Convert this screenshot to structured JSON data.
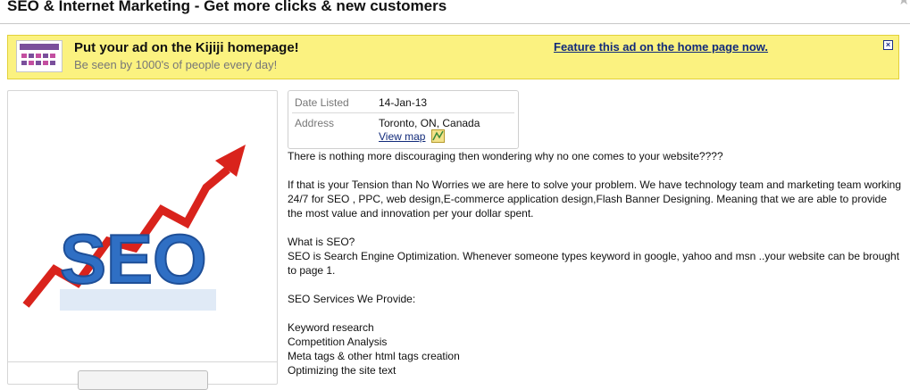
{
  "listing": {
    "title": "SEO & Internet Marketing - Get more clicks & new customers"
  },
  "promo": {
    "headline": "Put your ad on the Kijiji homepage!",
    "subline": "Be seen by 1000's of people every day!",
    "link": "Feature this ad on the home page now.",
    "close": "×"
  },
  "image": {
    "alt_word": "SEO"
  },
  "details": {
    "date_label": "Date Listed",
    "date_value": "14-Jan-13",
    "address_label": "Address",
    "address_value": "Toronto, ON, Canada",
    "map_link": "View map"
  },
  "description": {
    "p1": "There is nothing more discouraging then wondering why no one comes to your website????",
    "p2": "If that is your Tension than No Worries we are here to solve your problem. We have technology team and marketing team working 24/7 for SEO , PPC, web design,E-commerce application design,Flash Banner Designing. Meaning that we are able to provide the most value and innovation per your dollar spent.",
    "q_heading": "What is SEO?",
    "q_answer": "SEO is Search Engine Optimization. Whenever someone types keyword in google, yahoo and msn ..your website can be brought to page 1.",
    "services_heading": "SEO Services We Provide:",
    "services": [
      "Keyword research",
      "Competition Analysis",
      "Meta tags & other html tags creation",
      "Optimizing the site text"
    ]
  },
  "colors": {
    "banner_bg": "#fbf280",
    "link": "#112a7a",
    "arrow": "#d9231c",
    "seo_blue": "#2f6fc4"
  }
}
